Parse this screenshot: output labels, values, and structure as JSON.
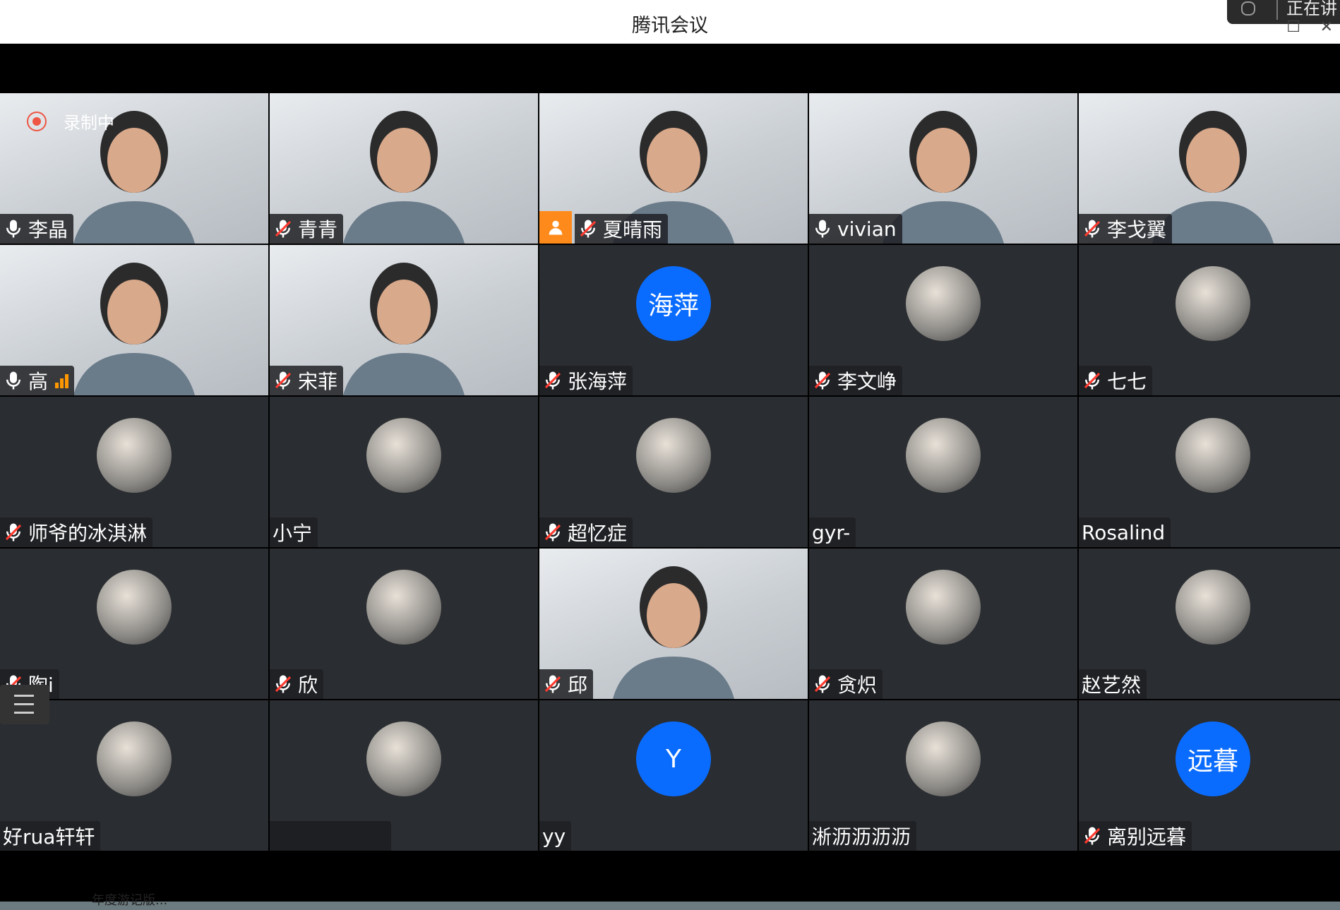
{
  "window": {
    "title": "腾讯会议",
    "corner_text": "正在讲"
  },
  "recording": {
    "label": "录制中"
  },
  "participants": [
    {
      "name": "李晶",
      "mic": "on",
      "video": true
    },
    {
      "name": "青青",
      "mic": "muted",
      "video": true
    },
    {
      "name": "夏晴雨",
      "mic": "muted",
      "video": true,
      "host": true
    },
    {
      "name": "vivian",
      "mic": "on",
      "video": true
    },
    {
      "name": "李戈翼",
      "mic": "muted",
      "video": true
    },
    {
      "name": "高",
      "mic": "on",
      "video": true,
      "signal": true
    },
    {
      "name": "宋菲",
      "mic": "muted",
      "video": true
    },
    {
      "name": "张海萍",
      "mic": "muted",
      "avatar_text": "海萍"
    },
    {
      "name": "李文峥",
      "mic": "muted"
    },
    {
      "name": "七七",
      "mic": "muted"
    },
    {
      "name": "师爷的冰淇淋",
      "mic": "muted"
    },
    {
      "name": "小宁",
      "mic": "none"
    },
    {
      "name": "超忆症",
      "mic": "muted"
    },
    {
      "name": "gyr-",
      "mic": "none"
    },
    {
      "name": "Rosalind",
      "mic": "none"
    },
    {
      "name": "陶i",
      "mic": "muted"
    },
    {
      "name": "欣",
      "mic": "muted"
    },
    {
      "name": "邱",
      "mic": "muted",
      "video": true
    },
    {
      "name": "贪炽",
      "mic": "muted"
    },
    {
      "name": "赵艺然",
      "mic": "none"
    },
    {
      "name": "好rua轩轩",
      "mic": "none"
    },
    {
      "name": "",
      "mic": "none"
    },
    {
      "name": "yy",
      "mic": "none",
      "avatar_text": "Y"
    },
    {
      "name": "淅沥沥沥沥",
      "mic": "none"
    },
    {
      "name": "离别远暮",
      "mic": "muted",
      "avatar_text": "远暮"
    }
  ],
  "bottom_text": "年度游记版..."
}
